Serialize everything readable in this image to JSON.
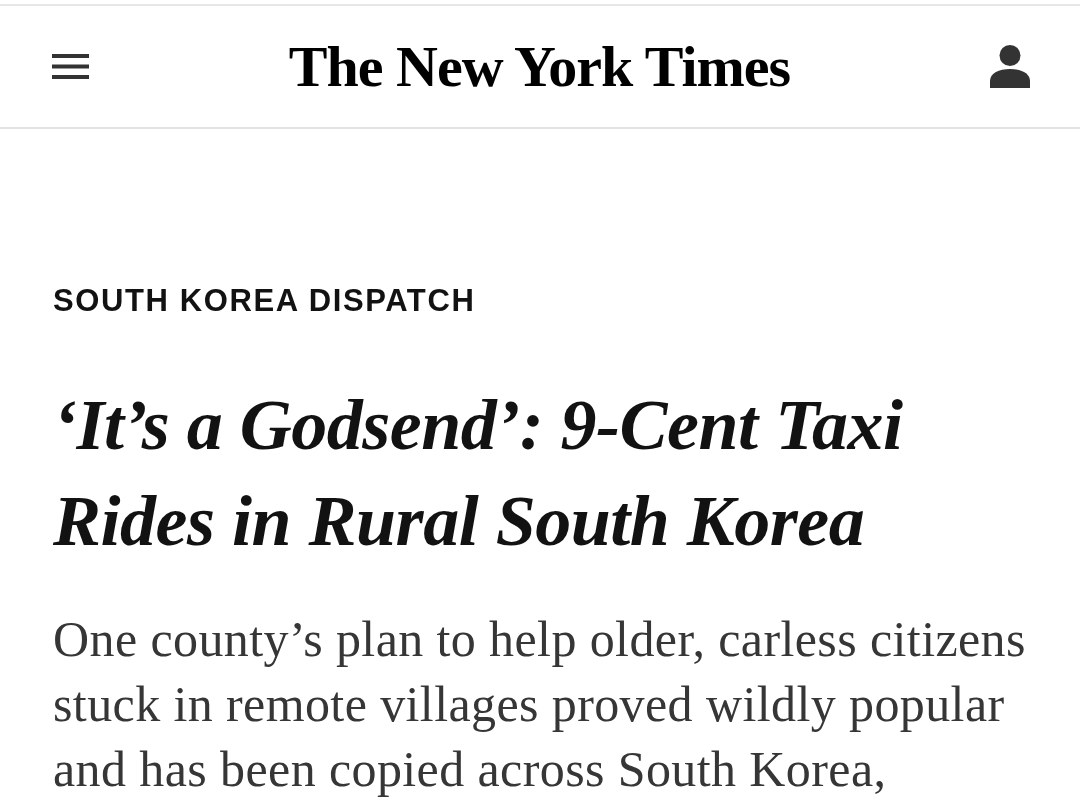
{
  "header": {
    "logo": "The New York Times"
  },
  "article": {
    "kicker": "SOUTH KOREA DISPATCH",
    "headline": "‘It’s a Godsend’: 9-Cent Taxi Rides in Rural South Korea",
    "summary": "One county’s plan to help older, carless citizens stuck in remote villages proved wildly popular and has been copied across South Korea,"
  }
}
